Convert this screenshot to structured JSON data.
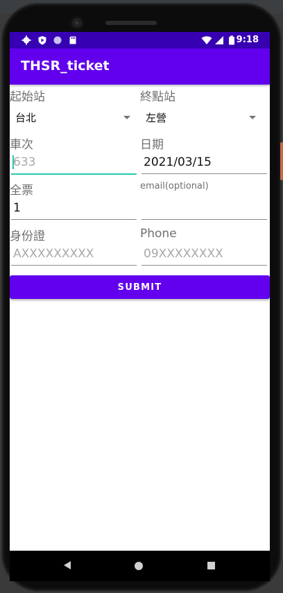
{
  "status_bar": {
    "time": "9:18",
    "left_icons": [
      "gear-icon",
      "shield-play-icon",
      "circle-icon",
      "sd-card-icon"
    ],
    "right_icons": [
      "wifi-icon",
      "signal-icon",
      "battery-icon"
    ]
  },
  "app_bar": {
    "title": "THSR_ticket"
  },
  "form": {
    "origin_label": "起始站",
    "origin_value": "台北",
    "destination_label": "終點站",
    "destination_value": "左營",
    "train_no_label": "車次",
    "train_no_placeholder": "633",
    "date_label": "日期",
    "date_value": "2021/03/15",
    "ticket_type_label": "全票",
    "ticket_count_value": "1",
    "email_label": "email(optional)",
    "email_value": "",
    "id_label": "身份證",
    "id_placeholder": "AXXXXXXXXX",
    "phone_label": "Phone",
    "phone_placeholder": "09XXXXXXXX"
  },
  "submit_label": "SUBMIT",
  "nav_bar": {
    "icons": [
      "back-icon",
      "home-icon",
      "recents-icon"
    ]
  },
  "colors": {
    "primary": "#6200ee",
    "primary_dark": "#3700b3",
    "accent": "#26c6b0"
  }
}
